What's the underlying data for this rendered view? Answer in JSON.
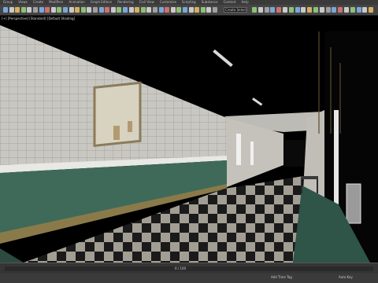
{
  "menu": {
    "items": [
      "Group",
      "Views",
      "Create",
      "Modifiers",
      "Animation",
      "Graph Editors",
      "Rendering",
      "Civil View",
      "Customize",
      "Scripting",
      "Substance",
      "Content",
      "Help"
    ]
  },
  "toolbar": {
    "selection_set_placeholder": "Create Selection Set"
  },
  "viewport": {
    "label": "[+] [Perspective] [Standard] [Default Shading]"
  },
  "timeline": {
    "frame_counter": "0 / 100"
  },
  "statusbar": {
    "add_time_tag": "Add Time Tag",
    "auto_key_label": "Auto Key"
  },
  "colors": {
    "ui_bg": "#3a3a3a",
    "wall_tile": "#c8c6c0",
    "wainscot_green": "#3f6a59",
    "floor_dark": "#1b1b1b",
    "floor_light": "#9d9a90"
  }
}
